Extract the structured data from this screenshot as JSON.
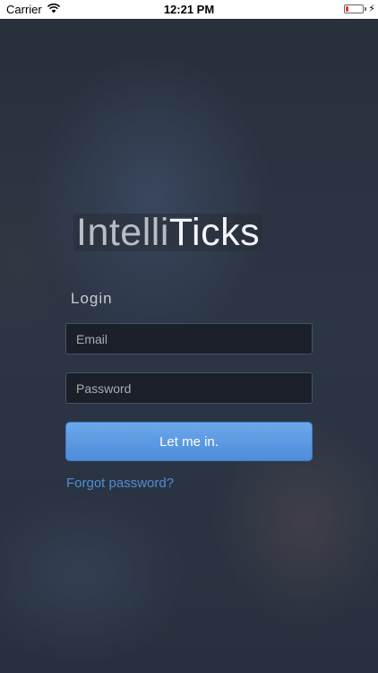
{
  "status_bar": {
    "carrier": "Carrier",
    "time": "12:21 PM",
    "battery_level": 0.15,
    "battery_color": "#e53b30",
    "icons": [
      "wifi-icon",
      "battery-icon",
      "charging-bolt-icon"
    ]
  },
  "app": {
    "logo_light": "Intelli",
    "logo_bold": "Ticks"
  },
  "login": {
    "title": "Login",
    "email_placeholder": "Email",
    "password_placeholder": "Password",
    "submit_label": "Let me in.",
    "forgot_label": "Forgot password?"
  },
  "colors": {
    "accent": "#5c9be3",
    "link": "#4f8dd6",
    "background": "#2a3342"
  }
}
